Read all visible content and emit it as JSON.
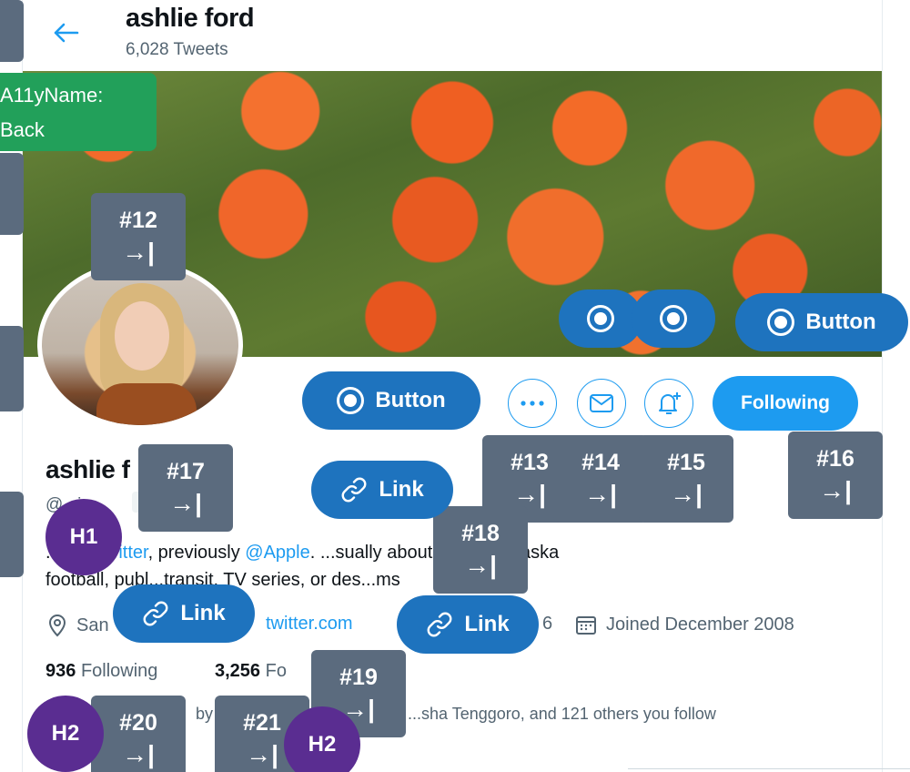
{
  "header": {
    "name": "ashlie ford",
    "tweet_count": "6,028 Tweets"
  },
  "profile": {
    "display_name": "ashlie f",
    "handle": "@...ie",
    "follows_badge": "F...",
    "bio": {
      "start": "...er ",
      "mention1": "@twitter",
      "mid": ", previously ",
      "mention2": "@Apple",
      "tail": ". ...sually about cats, Nebraska",
      "line2": "football, publ...transit, TV series, or des...ms"
    },
    "location": "San",
    "website": "twitter.com",
    "birthday_fragment": "6",
    "joined": "Joined December 2008",
    "following_count": "936",
    "following_label": "Following",
    "followers_count": "3,256",
    "followers_label": "Fo",
    "followed_by": "...sha Tenggoro, and 121 others you follow",
    "followed_by_prefix": "by"
  },
  "actions": {
    "following_label": "Following"
  },
  "icons": {
    "back": "arrow-left-icon",
    "more": "more-icon",
    "message": "envelope-icon",
    "notify": "bell-plus-icon",
    "location": "location-pin-icon",
    "calendar": "calendar-icon",
    "link": "link-icon"
  },
  "a11y": {
    "tooltip_label": "A11yName:",
    "tooltip_value": "Back",
    "button_label": "Button",
    "link_label": "Link",
    "tab_arrow": "→|",
    "tabstops": [
      "#12",
      "#13",
      "#14",
      "#15",
      "#16",
      "#17",
      "#18",
      "#19",
      "#20",
      "#21"
    ],
    "headings": [
      "H1",
      "H2",
      "H2"
    ]
  },
  "colors": {
    "accent": "#1d9bf0",
    "tab_stop": "#5b6b7e",
    "overlay_blue": "#1e73be",
    "heading": "#5a2d91",
    "name_tooltip": "#22a05a"
  }
}
